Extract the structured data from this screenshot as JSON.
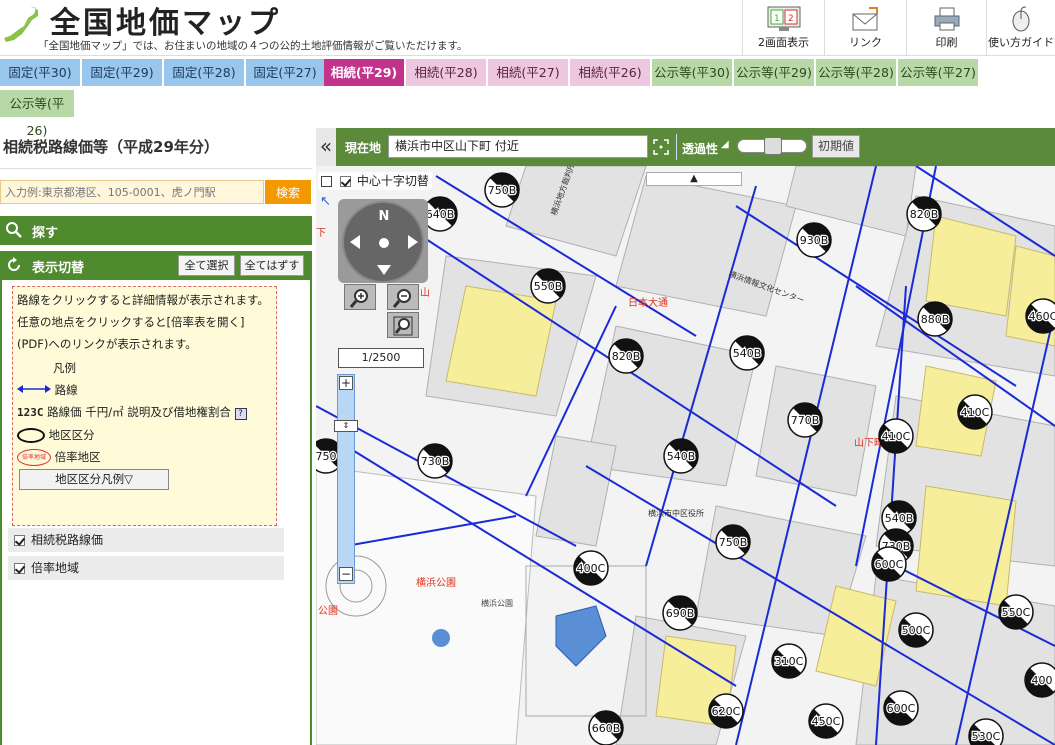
{
  "header": {
    "title": "全国地価マップ",
    "description": "「全国地価マップ」では、お住まいの地域の４つの公的土地評価情報がご覧いただけます。",
    "tools": [
      {
        "label": "2画面表示",
        "icon": "dual-screen-icon"
      },
      {
        "label": "リンク",
        "icon": "envelope-icon"
      },
      {
        "label": "印刷",
        "icon": "printer-icon"
      },
      {
        "label": "使い方ガイド",
        "icon": "mouse-icon"
      }
    ]
  },
  "tabs": [
    {
      "label": "固定(平30)",
      "kind": "fixed"
    },
    {
      "label": "固定(平29)",
      "kind": "fixed"
    },
    {
      "label": "固定(平28)",
      "kind": "fixed"
    },
    {
      "label": "固定(平27)",
      "kind": "fixed"
    },
    {
      "label": "相続(平29)",
      "kind": "inherit",
      "active": true
    },
    {
      "label": "相続(平28)",
      "kind": "inherit"
    },
    {
      "label": "相続(平27)",
      "kind": "inherit"
    },
    {
      "label": "相続(平26)",
      "kind": "inherit"
    },
    {
      "label": "公示等(平30)",
      "kind": "public"
    },
    {
      "label": "公示等(平29)",
      "kind": "public"
    },
    {
      "label": "公示等(平28)",
      "kind": "public"
    },
    {
      "label": "公示等(平27)",
      "kind": "public"
    },
    {
      "label": "公示等(平26)",
      "kind": "public"
    }
  ],
  "panel": {
    "title": "相続税路線価等（平成29年分）",
    "search_placeholder": "入力例:東京都港区、105-0001、虎ノ門駅",
    "search_button": "検索",
    "find_label": "探す",
    "toggle_label": "表示切替",
    "select_all": "全て選択",
    "deselect_all": "全てはずす",
    "legend": {
      "line1": "路線をクリックすると詳細情報が表示されます。",
      "line2": "任意の地点をクリックすると[倍率表を開く](PDF)へのリンクが表示されます。",
      "heading": "凡例",
      "route": "路線",
      "price_sample": "123C",
      "price_text": "路線価 千円/㎡ 説明及び借地権割合",
      "district": "地区区分",
      "ratio_sample": "倍率地域",
      "ratio": "倍率地区",
      "district_button": "地区区分凡例▽"
    },
    "layers": [
      "相続税路線価",
      "倍率地域"
    ]
  },
  "map": {
    "location_label": "現在地",
    "location_value": "横浜市中区山下町 付近",
    "transparency_label": "透過性",
    "reset_button": "初期値",
    "crosshair_label": "中心十字切替",
    "scale": "1/2500",
    "compass_n": "N",
    "zoom_plus": "+",
    "zoom_minus": "−",
    "place_labels": [
      "日本大通",
      "山下町",
      "横浜公園",
      "横浜公園",
      "公園",
      "下",
      "山",
      "横浜市中区役所",
      "横浜情報文化センター",
      "横浜地方裁判所"
    ],
    "price_markers": [
      {
        "label": "750B",
        "type": "B"
      },
      {
        "label": "640B",
        "type": "B"
      },
      {
        "label": "550B",
        "type": "B"
      },
      {
        "label": "820B",
        "type": "B"
      },
      {
        "label": "540B",
        "type": "B"
      },
      {
        "label": "930B",
        "type": "B"
      },
      {
        "label": "820B",
        "type": "B"
      },
      {
        "label": "880B",
        "type": "B"
      },
      {
        "label": "460C",
        "type": "C"
      },
      {
        "label": "540B",
        "type": "B"
      },
      {
        "label": "770B",
        "type": "B"
      },
      {
        "label": "410C",
        "type": "C"
      },
      {
        "label": "410C",
        "type": "C"
      },
      {
        "label": "750",
        "type": "B"
      },
      {
        "label": "730B",
        "type": "B"
      },
      {
        "label": "540B",
        "type": "B"
      },
      {
        "label": "400C",
        "type": "C"
      },
      {
        "label": "750B",
        "type": "B"
      },
      {
        "label": "730B",
        "type": "B"
      },
      {
        "label": "600C",
        "type": "C"
      },
      {
        "label": "690B",
        "type": "B"
      },
      {
        "label": "550C",
        "type": "C"
      },
      {
        "label": "500C",
        "type": "C"
      },
      {
        "label": "310C",
        "type": "C"
      },
      {
        "label": "620C",
        "type": "C"
      },
      {
        "label": "600C",
        "type": "C"
      },
      {
        "label": "450C",
        "type": "C"
      },
      {
        "label": "660B",
        "type": "B"
      },
      {
        "label": "530C",
        "type": "C"
      },
      {
        "label": "400",
        "type": "C"
      }
    ]
  },
  "colors": {
    "green": "#4f8a2f",
    "fixed_tab": "#99c6ec",
    "inherit_tab": "#edc6df",
    "inherit_active": "#c2338b",
    "public_tab": "#b9d8a8",
    "route_blue": "#1a2bd6"
  }
}
